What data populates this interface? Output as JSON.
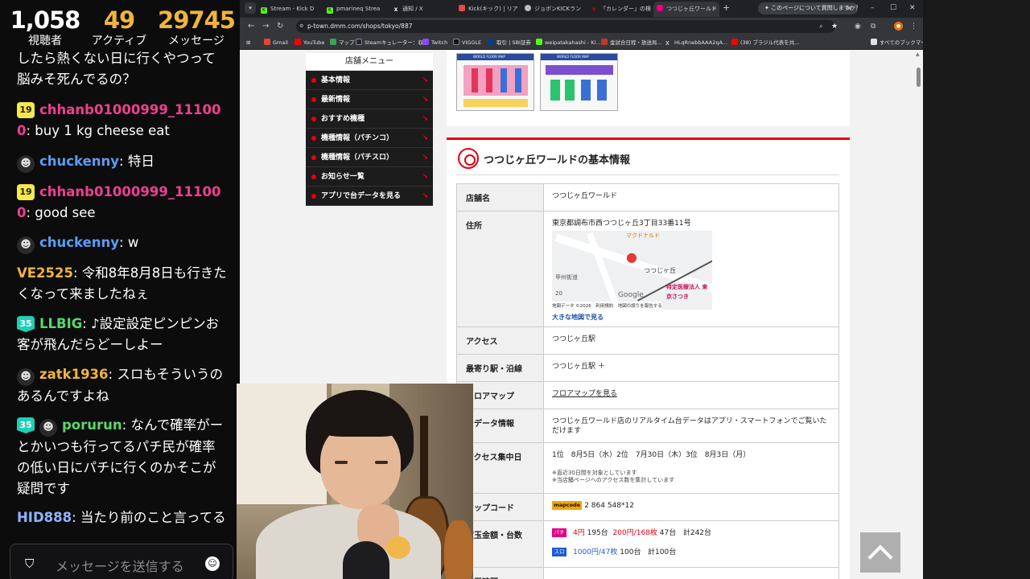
{
  "stream_stats": {
    "viewers": {
      "value": "1,058",
      "label": "視聴者"
    },
    "active": {
      "value": "49",
      "label": "アクティブ"
    },
    "messages": {
      "value": "29745",
      "label": "メッセージ"
    }
  },
  "chat": {
    "messages": [
      {
        "user": "",
        "text": "したら熱くない日に行くやつって脳みそ死んでるの？"
      },
      {
        "badge": "19",
        "user": "chhanb01000999_111000",
        "user_color": "#ef3f8f",
        "text": "buy 1 kg cheese eat"
      },
      {
        "avatar": true,
        "user": "chuckenny",
        "user_color": "#5b9cf2",
        "text": "特日"
      },
      {
        "badge": "19",
        "user": "chhanb01000999_111000",
        "user_color": "#ef3f8f",
        "text": "good see"
      },
      {
        "avatar": true,
        "user": "chuckenny",
        "user_color": "#5b9cf2",
        "text": "w"
      },
      {
        "user": "VE2525",
        "user_color": "#f1b53c",
        "text": "令和8年8月8日も行きたくなって来ましたねぇ"
      },
      {
        "badge": "35",
        "user": "LLBIG",
        "user_color": "#56d96a",
        "text": "♪設定設定ピンピンお客が飛んだらどーしよー"
      },
      {
        "avatar": true,
        "user": "zatk1936",
        "user_color": "#f1b53c",
        "text": "スロもそういうのあるんですよね"
      },
      {
        "badge": "35",
        "avatar": true,
        "user": "porurun",
        "user_color": "#56d96a",
        "text": "なんで確率がーとかいつも行ってるパチ民が確率の低い日にパチに行くのかそこが疑問です"
      },
      {
        "user": "HID888",
        "user_color": "#8fb3ff",
        "text": "当たり前のこと言ってる"
      }
    ],
    "input_placeholder": "メッセージを送信する"
  },
  "browser": {
    "tabs": [
      {
        "title": "Stream - Kick D",
        "icon": "kick-icon",
        "color": "#53fc18"
      },
      {
        "title": "pmarineq Strea",
        "icon": "kick-icon",
        "color": "#53fc18"
      },
      {
        "title": "通知 / X",
        "icon": "x-icon",
        "color": "#ffffff"
      },
      {
        "title": "Kick(キック) | リア",
        "icon": "kick-site-icon",
        "color": "#e34a4a"
      },
      {
        "title": "ジョボンKICKラン",
        "icon": "globe-icon",
        "color": "#bbbbbb"
      },
      {
        "title": "「カレンダー」の検",
        "icon": "calendar-icon",
        "color": "#e60012"
      },
      {
        "title": "つつじヶ丘ワールド",
        "icon": "p-town-icon",
        "color": "#e60086",
        "active": true
      }
    ],
    "ai_prompt": "このページについて質問しますか？",
    "url": "p-town.dmm.com/shops/tokyo/887",
    "bookmarks": [
      {
        "label": "Gmail",
        "color": "#ea4335"
      },
      {
        "label": "YouTube",
        "color": "#ff0000"
      },
      {
        "label": "マップ",
        "color": "#34a853"
      },
      {
        "label": "Steamキュレーター：収...",
        "color": "#1b2838"
      },
      {
        "label": "Twitch",
        "color": "#9146ff"
      },
      {
        "label": "VIGGLE",
        "color": "#111111"
      },
      {
        "label": "取引 | SBI証券",
        "color": "#0b3b8c"
      },
      {
        "label": "weipatakahashi - Ki...",
        "color": "#53fc18"
      },
      {
        "label": "金試合日程・放送局...",
        "color": "#c0392b"
      },
      {
        "label": "HLqRnebbAAA2qA...",
        "color": "#ffffff"
      },
      {
        "label": "(38) ブラジル代表を共...",
        "color": "#ff0000"
      }
    ],
    "all_bookmarks": "すべてのブックマーク"
  },
  "page": {
    "shop_menu": {
      "title": "店舗メニュー",
      "items": [
        "基本情報",
        "最新情報",
        "おすすめ機種",
        "機種情報（パチンコ）",
        "機種情報（パチスロ）",
        "お知らせ一覧",
        "アプリで台データを見る"
      ]
    },
    "floor_map_header": "WORLD FLOOR MAP",
    "info": {
      "title": "つつじヶ丘ワールドの基本情報",
      "store_name_label": "店舗名",
      "store_name": "つつじヶ丘ワールド",
      "address_label": "住所",
      "address": "東京都調布市西つつじヶ丘3丁目33番11号",
      "map": {
        "station_label": "つつじヶ丘",
        "clinic_label": "特定医療法人 東京さつき",
        "mcd_label": "マクドナルド",
        "road_label": "甲州街道",
        "route_number": "20",
        "credit": "地図データ ©2026　利用規約　地図の誤りを報告する",
        "google": "Google",
        "large_map_link": "大きな地図で見る"
      },
      "access_label": "アクセス",
      "access": "つつじヶ丘駅",
      "nearest_label": "最寄り駅・沿線",
      "nearest": "つつじヶ丘駅 ＋",
      "floor_label": "フロアマップ",
      "floor_link": "フロアマップを見る",
      "data_label": "台データ情報",
      "data_text": "つつじヶ丘ワールド店のリアルタイム台データはアプリ・スマートフォンでご覧いただけます",
      "busy_label": "アクセス集中日",
      "busy_text": "1位　8月5日（水）2位　7月30日（木）3位　8月3日（月）",
      "busy_note1": "※直近30日間を対象としています",
      "busy_note2": "※当店舗ページへのアクセス数を集計しています",
      "mapcode_label": "マップコード",
      "mapcode_logo": "mapcode",
      "mapcode": "2 864 548*12",
      "rate_label": "貸玉金額・台数",
      "pachi_tag": "パチ",
      "pachi_rate1": "4円",
      "pachi_count1": "195台",
      "pachi_rate2": "200円/168枚",
      "pachi_count2": "47台",
      "pachi_total": "計242台",
      "slo_tag": "スロ",
      "slo_rate": "1000円/47枚",
      "slo_count": "100台",
      "slo_total": "計100台",
      "hours_label": "営業時間"
    }
  },
  "colors": {
    "accent_red": "#e60012",
    "chat_gold": "#f1b53c",
    "browser_dark": "#202124"
  }
}
